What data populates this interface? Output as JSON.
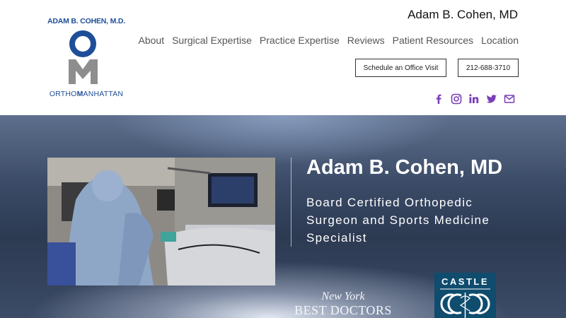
{
  "logo": {
    "top_text": "ADAM B. COHEN, M.D.",
    "bottom_prefix": "ORTHO",
    "bottom_bold": "M",
    "bottom_suffix": "ANHATTAN",
    "colors": {
      "blue": "#1f4e99",
      "gray": "#8e8e8e"
    }
  },
  "header": {
    "site_title": "Adam B. Cohen, MD",
    "nav": [
      "About",
      "Surgical Expertise",
      "Practice Expertise",
      "Reviews",
      "Patient Resources",
      "Location"
    ],
    "buttons": {
      "visit": "Schedule an Office Visit",
      "phone": "212-688-3710"
    },
    "social_icons": [
      "facebook-icon",
      "instagram-icon",
      "linkedin-icon",
      "twitter-icon",
      "mail-icon"
    ],
    "social_color": "#7b3fb7"
  },
  "hero": {
    "title": "Adam B. Cohen, MD",
    "subtitle": "Board Certified Orthopedic Surgeon and Sports Medicine Specialist",
    "badge_nybd_line1": "New York",
    "badge_nybd_line2": "BEST DOCTORS",
    "badge_castle": "CASTLE"
  }
}
